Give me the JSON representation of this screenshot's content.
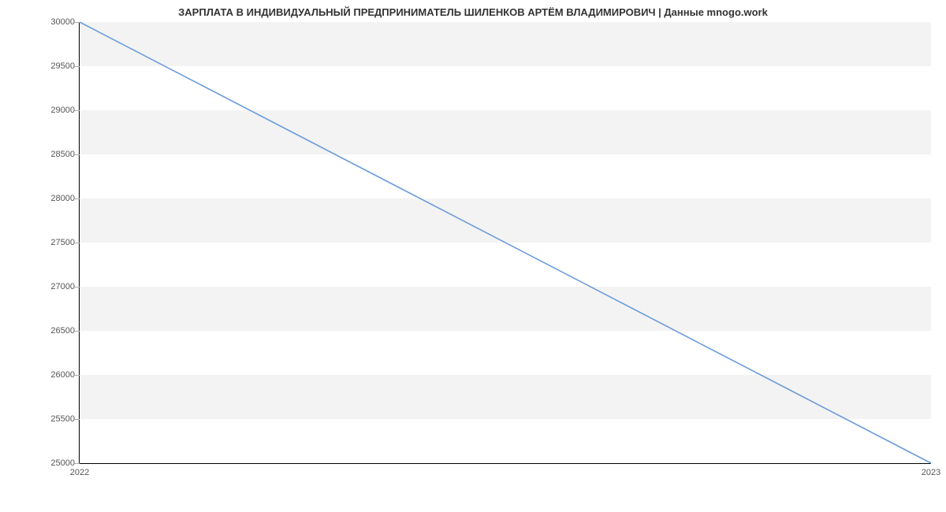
{
  "chart_data": {
    "type": "line",
    "title": "ЗАРПЛАТА В ИНДИВИДУАЛЬНЫЙ ПРЕДПРИНИМАТЕЛЬ ШИЛЕНКОВ АРТЁМ ВЛАДИМИРОВИЧ | Данные mnogo.work",
    "x": [
      "2022",
      "2023"
    ],
    "values": [
      30000,
      25000
    ],
    "xlabel": "",
    "ylabel": "",
    "ylim": [
      25000,
      30000
    ],
    "yticks": [
      25000,
      25500,
      26000,
      26500,
      27000,
      27500,
      28000,
      28500,
      29000,
      29500,
      30000
    ],
    "line_color": "#6b9bdc"
  }
}
